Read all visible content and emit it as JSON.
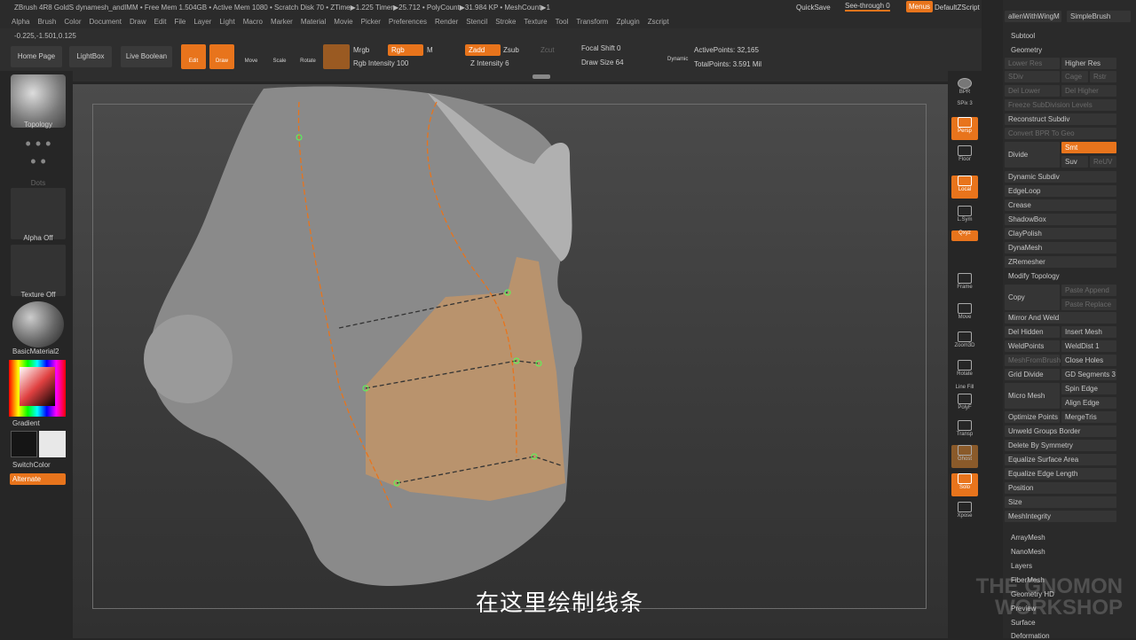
{
  "titlebar": {
    "info": "ZBrush 4R8 GoldS    dynamesh_andIMM    • Free Mem 1.504GB • Active Mem 1080 • Scratch Disk 70 • ZTime▶1.225 Timer▶25.712 • PolyCount▶31.984 KP • MeshCount▶1",
    "quicksave": "QuickSave",
    "seethrough": "See-through  0",
    "menus": "Menus",
    "defaultzscript": "DefaultZScript"
  },
  "menus": [
    "Alpha",
    "Brush",
    "Color",
    "Document",
    "Draw",
    "Edit",
    "File",
    "Layer",
    "Light",
    "Macro",
    "Marker",
    "Material",
    "Movie",
    "Picker",
    "Preferences",
    "Render",
    "Stencil",
    "Stroke",
    "Texture",
    "Tool",
    "Transform",
    "Zplugin",
    "Zscript"
  ],
  "coords": "-0.225,-1.501,0.125",
  "toolbar": {
    "home": "Home Page",
    "lightbox": "LightBox",
    "boolean": "Live Boolean",
    "edit": "Edit",
    "draw": "Draw",
    "move": "Move",
    "scale": "Scale",
    "rotate": "Rotate",
    "mrgb": "Mrgb",
    "rgb": "Rgb",
    "m": "M",
    "rgb_intensity": "Rgb Intensity 100",
    "zadd": "Zadd",
    "zsub": "Zsub",
    "zcut": "Zcut",
    "z_intensity": "Z Intensity 6",
    "focal": "Focal Shift 0",
    "drawsize": "Draw Size 64",
    "dynamic": "Dynamic",
    "active": "ActivePoints: 32,165",
    "total": "TotalPoints: 3.591 Mil"
  },
  "left": {
    "brush": "Topology",
    "stroke": "Dots",
    "alpha": "Alpha Off",
    "texture": "Texture Off",
    "material": "BasicMaterial2",
    "gradient": "Gradient",
    "switch": "SwitchColor",
    "alternate": "Alternate"
  },
  "shelf": {
    "bpr": "BPR",
    "spix": "SPix 3",
    "persp": "Persp",
    "floor": "Floor",
    "local": "Local",
    "lsym": "L.Sym",
    "xyz": "Qxyz",
    "frame": "Frame",
    "move": "Move",
    "zoom": "Zoom3D",
    "rotate": "Rotate",
    "linefill": "Line Fill",
    "polyf": "PolyF",
    "transp": "Transp",
    "ghost": "Ghost",
    "solo": "Solo",
    "xpose": "Xpose"
  },
  "tool": {
    "top": [
      "allenWithWingM",
      "SimpleBrush"
    ],
    "subtool": "Subtool",
    "geometry": "Geometry",
    "lower": "Lower Res",
    "higher": "Higher Res",
    "sdiv": "SDiv",
    "cage": "Cage",
    "rstr": "Rstr",
    "delLower": "Del Lower",
    "delHigher": "Del Higher",
    "freeze": "Freeze SubDivision Levels",
    "reconstruct": "Reconstruct Subdiv",
    "convert": "Convert BPR To Geo",
    "divide": "Divide",
    "smt": "Smt",
    "suv": "Suv",
    "reuv": "ReUV",
    "items": [
      "Dynamic Subdiv",
      "EdgeLoop",
      "Crease",
      "ShadowBox",
      "ClayPolish",
      "DynaMesh",
      "ZRemesher",
      "Modify Topology"
    ],
    "copy": "Copy",
    "pasteAppend": "Paste Append",
    "pasteReplace": "Paste Replace",
    "mirror": "Mirror And Weld",
    "delHidden": "Del Hidden",
    "insertMesh": "Insert Mesh",
    "weldPoints": "WeldPoints",
    "weldDist": "WeldDist 1",
    "meshFromBrush": "MeshFromBrush",
    "closeHoles": "Close Holes",
    "gridDivide": "Grid Divide",
    "gdSegments": "GD Segments 3",
    "microMesh": "Micro Mesh",
    "spinEdge": "Spin Edge",
    "alignEdge": "Align Edge",
    "optimize": "Optimize Points",
    "mergeTris": "MergeTris",
    "unweld": "Unweld Groups Border",
    "deleteSym": "Delete By Symmetry",
    "eqSurface": "Equalize Surface Area",
    "eqEdge": "Equalize Edge Length",
    "position": "Position",
    "size": "Size",
    "integrity": "MeshIntegrity",
    "bottom": [
      "ArrayMesh",
      "NanoMesh",
      "Layers",
      "FiberMesh",
      "Geometry HD",
      "Preview",
      "Surface",
      "Deformation"
    ]
  },
  "subtitle": "在这里绘制线条",
  "watermark": "THE GNOMON WORKSHOP",
  "colors": {
    "accent": "#e8741c",
    "swatch_black": "#151515",
    "swatch_white": "#e8e8e8"
  }
}
